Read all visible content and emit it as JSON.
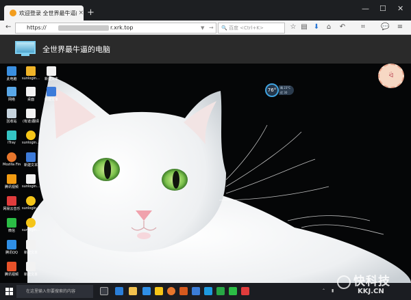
{
  "browser": {
    "tab": {
      "title": "欢迎登录 全世界最牛逼的...",
      "close": "×"
    },
    "new_tab": "+",
    "window_controls": {
      "minimize": "—",
      "maximize": "☐",
      "close": "✕"
    },
    "nav": {
      "back": "←",
      "forward": "→",
      "url_protocol": "https://",
      "url_host": "r.xrk.top",
      "go": "→",
      "search_placeholder": "百度 <Ctrl+K>"
    }
  },
  "app": {
    "title": "全世界最牛逼的电脑"
  },
  "desktop": {
    "icons_col1": [
      "此电脑",
      "网络",
      "回收站",
      "iTray",
      "Mozilla Firefox",
      "腾讯视频",
      "网易云音乐",
      "微信",
      "腾讯QQ",
      "腾讯视频"
    ],
    "icons_col2": [
      "sunlogin...",
      "桌面",
      "(有道)翻译",
      "sunlogin...",
      "新建文本",
      "sunlogin...",
      "sunlogin...",
      "sunlogin...",
      "新建文本",
      "新建文本"
    ],
    "icons_col3": [
      "新建文本",
      "新建文本"
    ],
    "weather": {
      "temp": "76°",
      "line1": "晴 23°C",
      "line2": "优 30"
    }
  },
  "taskbar": {
    "search_placeholder": "在这里输入你要搜索的内容"
  },
  "watermark": {
    "main": "快科技",
    "sub": "KKJ.CN"
  },
  "colors": {
    "tab_bg": "#1d1f22",
    "app_bar": "#2a2a2a",
    "accent": "#3fa3e0",
    "taskbar": "#1b1d22"
  }
}
